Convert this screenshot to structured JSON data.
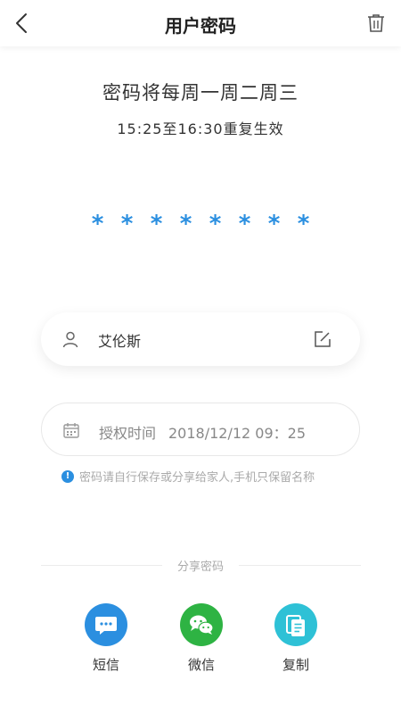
{
  "header": {
    "title": "用户密码"
  },
  "schedule": {
    "line1": "密码将每周一周二周三",
    "line2": "15:25至16:30重复生效"
  },
  "password": {
    "mask": [
      "*",
      "*",
      "*",
      "*",
      "*",
      "*",
      "*",
      "*"
    ]
  },
  "user": {
    "name": "艾伦斯"
  },
  "authorization": {
    "label": "授权时间",
    "value": "2018/12/12 09：25"
  },
  "notice": {
    "text": "密码请自行保存或分享给家人,手机只保留名称"
  },
  "share": {
    "title": "分享密码",
    "items": [
      {
        "label": "短信",
        "icon": "sms-icon",
        "color": "#2b8fe0"
      },
      {
        "label": "微信",
        "icon": "wechat-icon",
        "color": "#2eb343"
      },
      {
        "label": "复制",
        "icon": "copy-icon",
        "color": "#2ec1d6"
      }
    ]
  },
  "colors": {
    "accent": "#2b8fe0"
  }
}
